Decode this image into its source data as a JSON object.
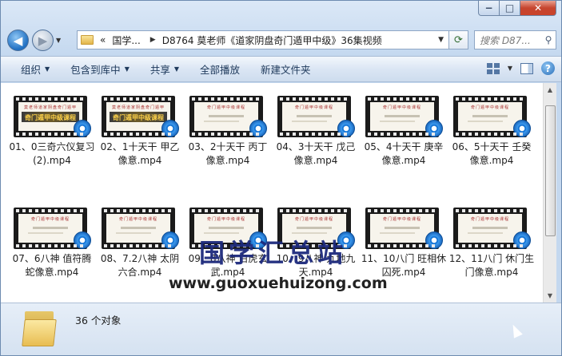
{
  "window": {
    "controls": {
      "minimize": "−",
      "maximize": "□",
      "close": "✕"
    }
  },
  "nav": {
    "back": "◀",
    "forward": "▶",
    "history": "▼"
  },
  "address": {
    "prefix": "«",
    "segments": [
      "国学...",
      "D8764 莫老师《道家阴盘奇门遁甲中级》36集视频"
    ],
    "separator": "▶",
    "dropdown": "▼"
  },
  "refresh": "⟳",
  "search": {
    "placeholder": "搜索 D87...",
    "icon": "search-icon"
  },
  "toolbar": {
    "organize": "组织",
    "include_library": "包含到库中",
    "share": "共享",
    "play_all": "全部播放",
    "new_folder": "新建文件夹",
    "help": "?"
  },
  "files": [
    {
      "name": "01、0三奇六仪复习 (2).mp4",
      "thumb_title": "莫老师道家阴盘奇门遁甲",
      "thumb_band": "奇门遁甲中级课程"
    },
    {
      "name": "02、1十天干 甲乙像意.mp4",
      "thumb_title": "莫老师道家阴盘奇门遁甲",
      "thumb_band": "奇门遁甲中级课程"
    },
    {
      "name": "03、2十天干 丙丁像意.mp4",
      "thumb_title": "奇门遁甲中级课程",
      "thumb_band": ""
    },
    {
      "name": "04、3十天干 戊己像意.mp4",
      "thumb_title": "奇门遁甲中级课程",
      "thumb_band": ""
    },
    {
      "name": "05、4十天干 庚辛像意.mp4",
      "thumb_title": "奇门遁甲中级课程",
      "thumb_band": ""
    },
    {
      "name": "06、5十天干 壬癸像意.mp4",
      "thumb_title": "奇门遁甲中级课程",
      "thumb_band": ""
    },
    {
      "name": "07、6八神 值符腾蛇像意.mp4",
      "thumb_title": "奇门遁甲中级课程",
      "thumb_band": ""
    },
    {
      "name": "08、7.2八神 太阴六合.mp4",
      "thumb_title": "奇门遁甲中级课程",
      "thumb_band": ""
    },
    {
      "name": "09、8八神 白虎玄武.mp4",
      "thumb_title": "奇门遁甲中级课程",
      "thumb_band": ""
    },
    {
      "name": "10、9八神 九地九天.mp4",
      "thumb_title": "奇门遁甲中级课程",
      "thumb_band": ""
    },
    {
      "name": "11、10八门 旺相休囚死.mp4",
      "thumb_title": "奇门遁甲中级课程",
      "thumb_band": ""
    },
    {
      "name": "12、11八门 休门生门像意.mp4",
      "thumb_title": "奇门遁甲中级课程",
      "thumb_band": ""
    }
  ],
  "watermark": {
    "title": "国学汇总站",
    "url": "www.guoxuehuizong.com"
  },
  "status": {
    "count": "36 个对象"
  },
  "colors": {
    "accent": "#1b78d6",
    "watermark": "#1d2a7d"
  }
}
